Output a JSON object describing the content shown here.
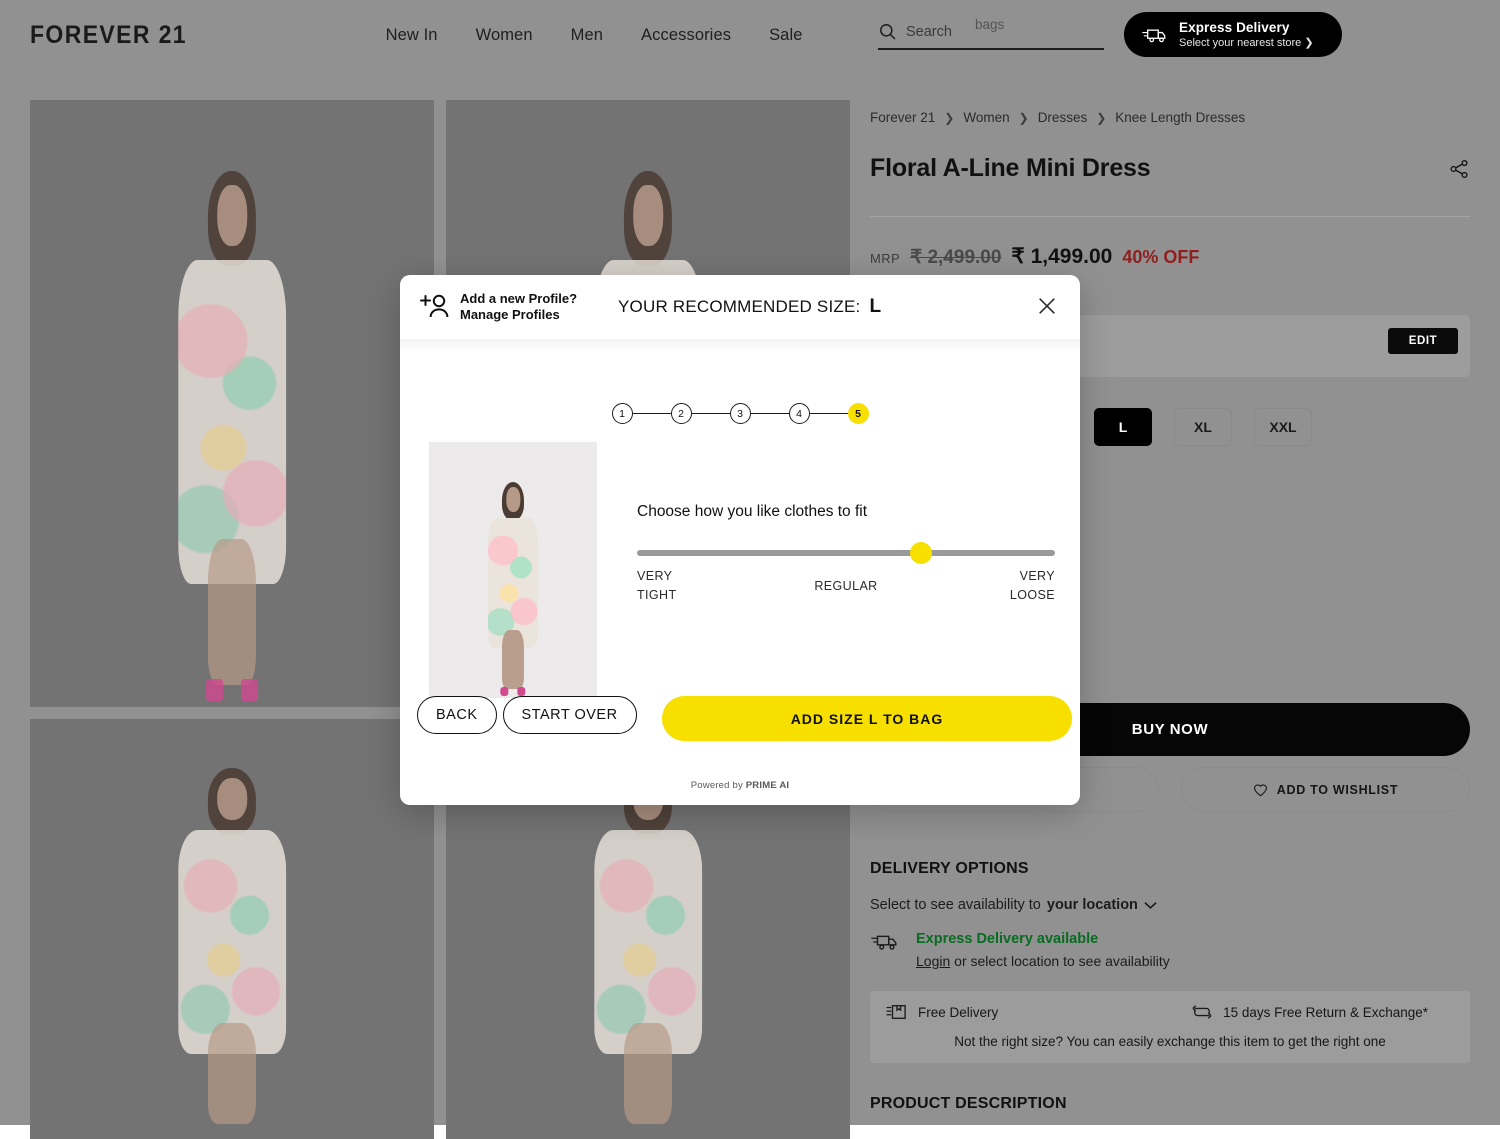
{
  "header": {
    "brand": "FOREVER 21",
    "nav": [
      {
        "label": "New In"
      },
      {
        "label": "Women"
      },
      {
        "label": "Men"
      },
      {
        "label": "Accessories"
      },
      {
        "label": "Sale"
      }
    ],
    "search": {
      "placeholder": "Search",
      "rotating_suggestion": "bags"
    },
    "express": {
      "title": "Express Delivery",
      "subtitle": "Select your nearest store ❯"
    }
  },
  "breadcrumb": [
    "Forever 21",
    "Women",
    "Dresses",
    "Knee Length Dresses"
  ],
  "product": {
    "title": "Floral A-Line Mini Dress",
    "mrp_label": "MRP",
    "mrp_original": "₹ 2,499.00",
    "price": "₹ 1,499.00",
    "discount": "40% OFF",
    "edit_label": "EDIT",
    "sizes": [
      {
        "label": "L",
        "selected": true
      },
      {
        "label": "XL",
        "selected": false
      },
      {
        "label": "XXL",
        "selected": false
      }
    ],
    "buy_now": "BUY NOW",
    "add_to_wishlist": "ADD TO WISHLIST",
    "product_description_heading": "PRODUCT DESCRIPTION"
  },
  "delivery": {
    "heading": "DELIVERY OPTIONS",
    "availability_prefix": "Select to see availability to",
    "location_label": "your location",
    "express_available": "Express Delivery available",
    "login_label": "Login",
    "login_rest": "or select location to see availability",
    "free_delivery": "Free Delivery",
    "returns": "15 days Free Return & Exchange*",
    "exchange_note": "Not the right size? You can easily exchange this item to get the right one"
  },
  "modal": {
    "profile_line1": "Add a new Profile?",
    "profile_line2": "Manage Profiles",
    "recommend_label": "YOUR RECOMMENDED SIZE:",
    "recommend_size": "L",
    "steps": [
      {
        "label": "1",
        "active": false
      },
      {
        "label": "2",
        "active": false
      },
      {
        "label": "3",
        "active": false
      },
      {
        "label": "4",
        "active": false
      },
      {
        "label": "5",
        "active": true
      }
    ],
    "fit_question": "Choose how you like clothes to fit",
    "slider": {
      "value_percent": 68,
      "label_left_1": "VERY",
      "label_left_2": "TIGHT",
      "label_mid": "REGULAR",
      "label_right_1": "VERY",
      "label_right_2": "LOOSE"
    },
    "back_label": "BACK",
    "start_over_label": "START OVER",
    "add_to_bag_label": "ADD SIZE L TO BAG",
    "powered_pre": "Powered by ",
    "powered_brand": "PRIME AI",
    "close_icon": "close-icon"
  },
  "colors": {
    "accent_yellow": "#F7DF00",
    "discount_red": "#8F1F1F",
    "success_green": "#0A6B22",
    "dim_background": "#919191"
  }
}
